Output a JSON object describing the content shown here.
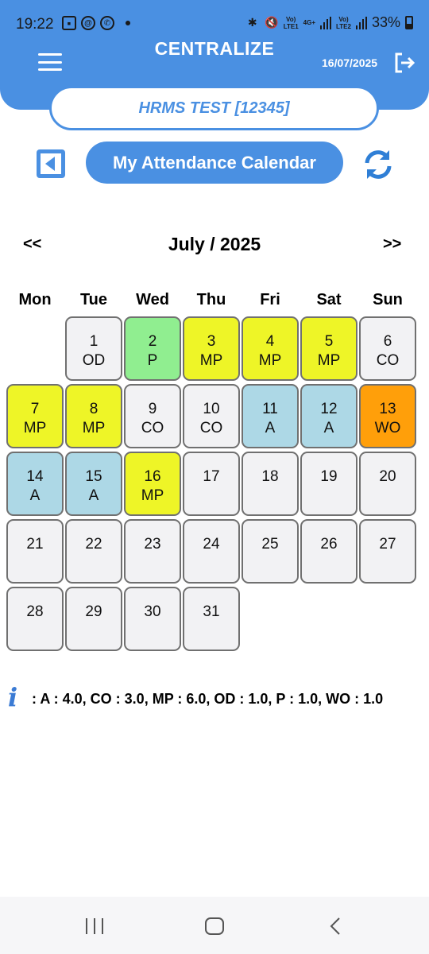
{
  "status_bar": {
    "time": "19:22",
    "battery": "33%",
    "network1": "LTE1",
    "network2": "LTE2",
    "data": "4G+"
  },
  "header": {
    "app_title": "CENTRALIZE",
    "date": "16/07/2025"
  },
  "company": {
    "name": "HRMS TEST [12345]"
  },
  "page": {
    "title": "My Attendance Calendar"
  },
  "calendar": {
    "prev_label": "<<",
    "next_label": ">>",
    "month_label": "July / 2025",
    "weekdays": [
      "Mon",
      "Tue",
      "Wed",
      "Thu",
      "Fri",
      "Sat",
      "Sun"
    ],
    "leading_blanks": 1,
    "days": [
      {
        "day": "1",
        "status": "OD"
      },
      {
        "day": "2",
        "status": "P"
      },
      {
        "day": "3",
        "status": "MP"
      },
      {
        "day": "4",
        "status": "MP"
      },
      {
        "day": "5",
        "status": "MP"
      },
      {
        "day": "6",
        "status": "CO"
      },
      {
        "day": "7",
        "status": "MP"
      },
      {
        "day": "8",
        "status": "MP"
      },
      {
        "day": "9",
        "status": "CO"
      },
      {
        "day": "10",
        "status": "CO"
      },
      {
        "day": "11",
        "status": "A"
      },
      {
        "day": "12",
        "status": "A"
      },
      {
        "day": "13",
        "status": "WO"
      },
      {
        "day": "14",
        "status": "A"
      },
      {
        "day": "15",
        "status": "A"
      },
      {
        "day": "16",
        "status": "MP"
      },
      {
        "day": "17",
        "status": ""
      },
      {
        "day": "18",
        "status": ""
      },
      {
        "day": "19",
        "status": ""
      },
      {
        "day": "20",
        "status": ""
      },
      {
        "day": "21",
        "status": ""
      },
      {
        "day": "22",
        "status": ""
      },
      {
        "day": "23",
        "status": ""
      },
      {
        "day": "24",
        "status": ""
      },
      {
        "day": "25",
        "status": ""
      },
      {
        "day": "26",
        "status": ""
      },
      {
        "day": "27",
        "status": ""
      },
      {
        "day": "28",
        "status": ""
      },
      {
        "day": "29",
        "status": ""
      },
      {
        "day": "30",
        "status": ""
      },
      {
        "day": "31",
        "status": ""
      }
    ],
    "status_colors": {
      "P": "#90ee90",
      "MP": "#eef527",
      "A": "#add8e6",
      "WO": "#ff9f0a",
      "OD": "#f2f2f4",
      "CO": "#f2f2f4",
      "": "#f2f2f4"
    }
  },
  "summary": {
    "text": ": A : 4.0, CO : 3.0, MP : 6.0, OD : 1.0, P : 1.0, WO : 1.0"
  },
  "colors": {
    "accent": "#4a90e2"
  }
}
